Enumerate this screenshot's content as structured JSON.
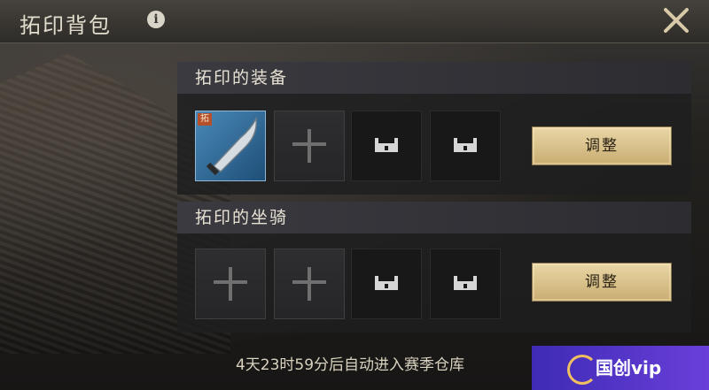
{
  "header": {
    "title": "拓印背包",
    "info_icon": "info-icon",
    "close_icon": "close-icon"
  },
  "equipment": {
    "title": "拓印的装备",
    "slots": [
      {
        "type": "item",
        "tag": "拓",
        "icon": "sword-icon"
      },
      {
        "type": "add"
      },
      {
        "type": "locked"
      },
      {
        "type": "locked"
      }
    ],
    "button": "调整"
  },
  "mounts": {
    "title": "拓印的坐骑",
    "slots": [
      {
        "type": "add"
      },
      {
        "type": "add"
      },
      {
        "type": "locked"
      },
      {
        "type": "locked"
      }
    ],
    "button": "调整"
  },
  "timer_text": "4天23时59分后自动进入赛季仓库",
  "watermark": {
    "text": "国创vip"
  },
  "colors": {
    "accent_button": "#d8c08a",
    "item_blue": "#3a78a8"
  }
}
